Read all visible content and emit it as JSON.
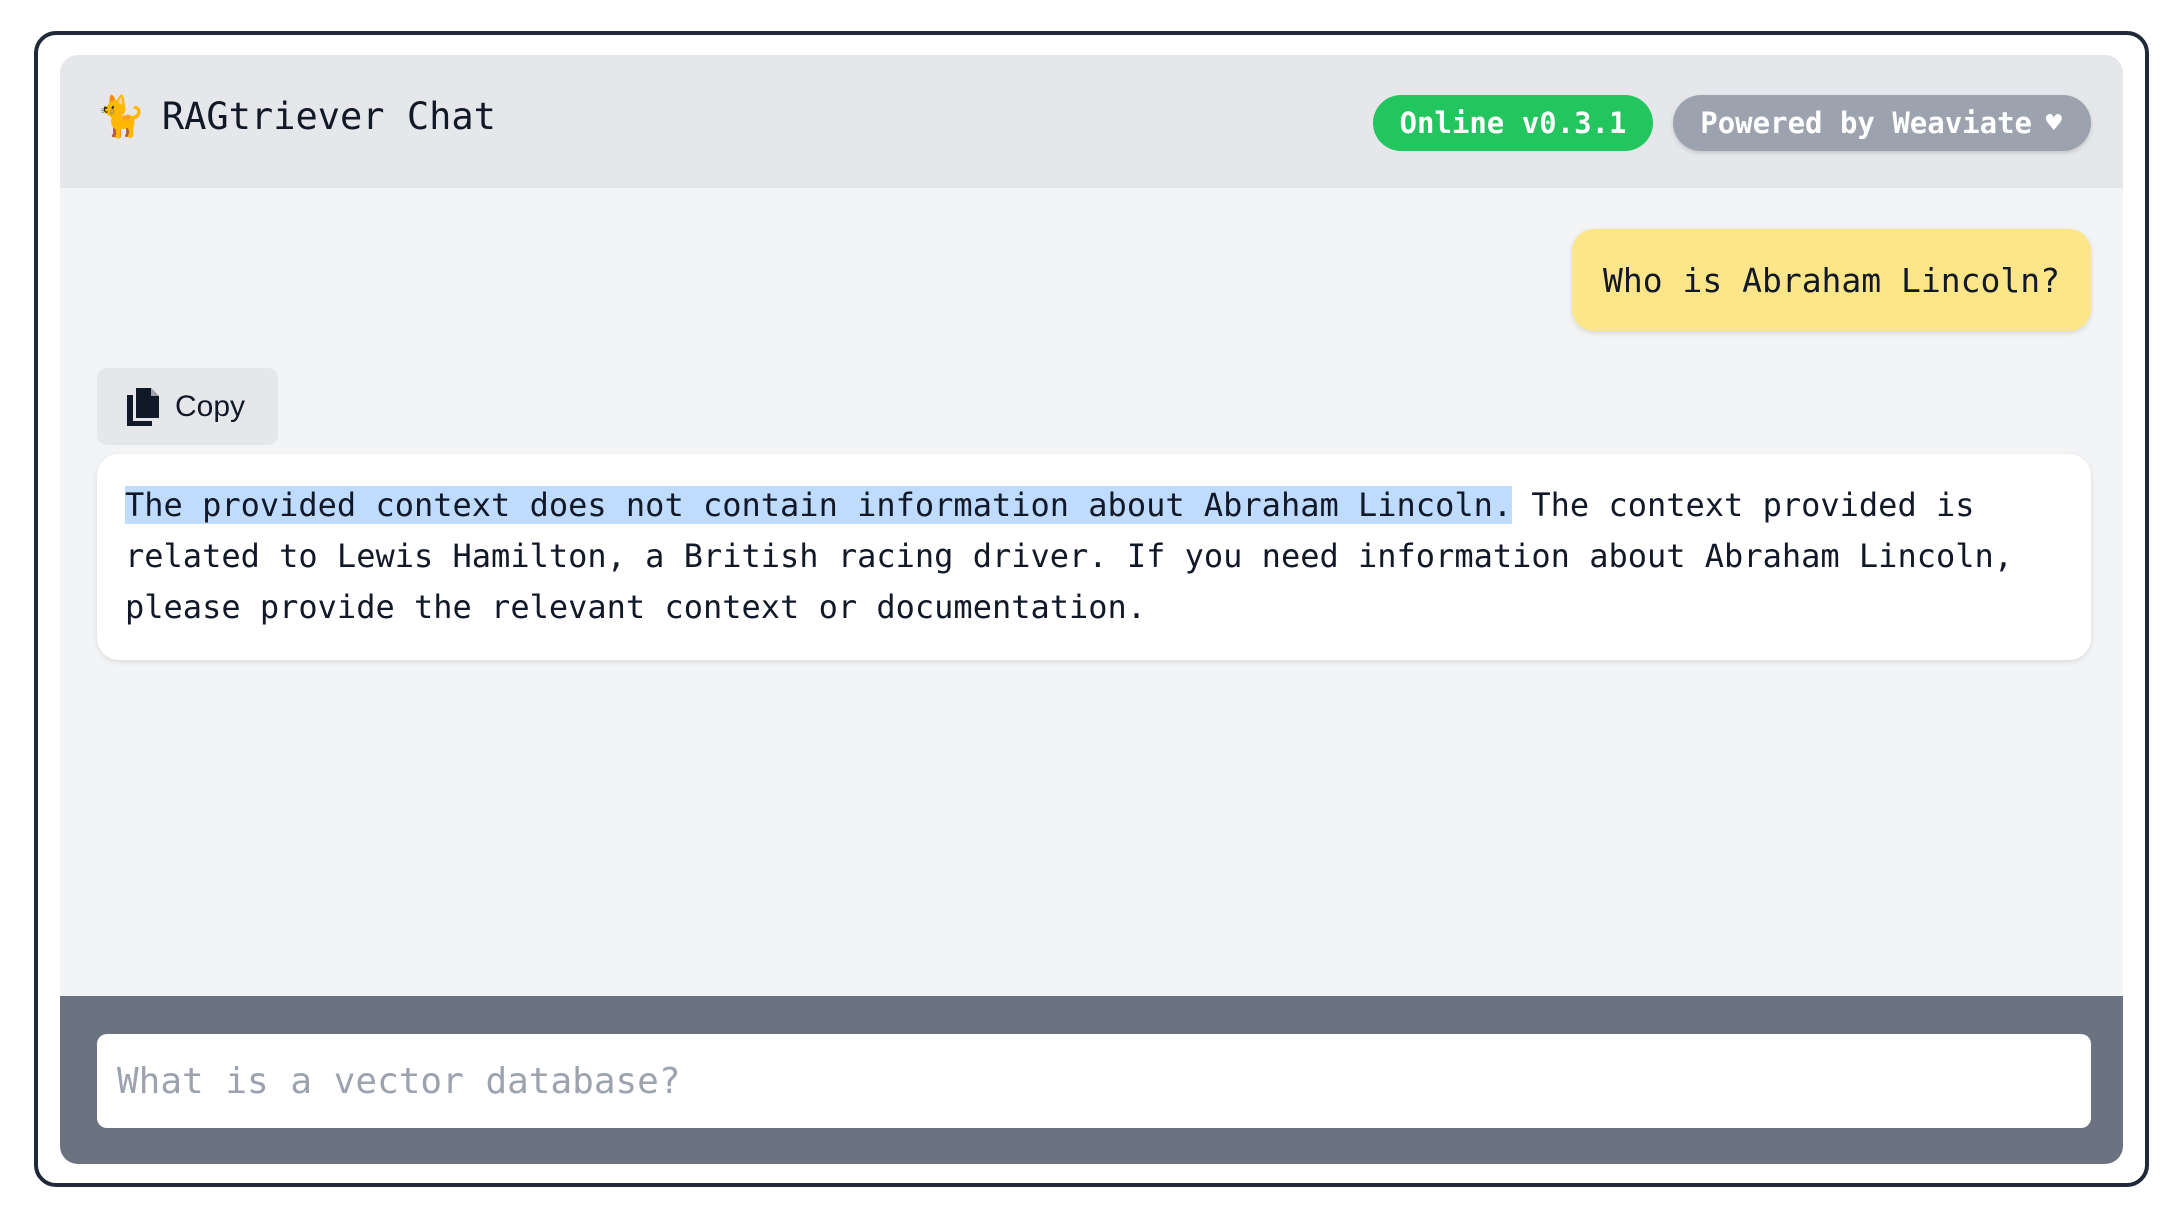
{
  "header": {
    "app_icon": "cat-icon",
    "title": "RAGtriever Chat",
    "status_badge": "Online v0.3.1",
    "powered_badge": "Powered by Weaviate",
    "powered_icon": "heart-icon"
  },
  "messages": {
    "user": {
      "text": "Who is Abraham Lincoln?"
    },
    "bot": {
      "copy_label": "Copy",
      "copy_icon": "copy-icon",
      "highlighted_text": "The provided context does not contain information about Abraham Lincoln.",
      "rest_text": " The context provided is related to Lewis Hamilton, a British racing driver. If you need information about Abraham Lincoln, please provide the relevant context or documentation."
    }
  },
  "input": {
    "placeholder": "What is a vector database?",
    "value": ""
  },
  "colors": {
    "status_online": "#22c55e",
    "powered_badge": "#9ca3af",
    "user_bubble": "#fde68a",
    "selection_highlight": "#bfdbfe",
    "input_bar": "#6b7280"
  }
}
